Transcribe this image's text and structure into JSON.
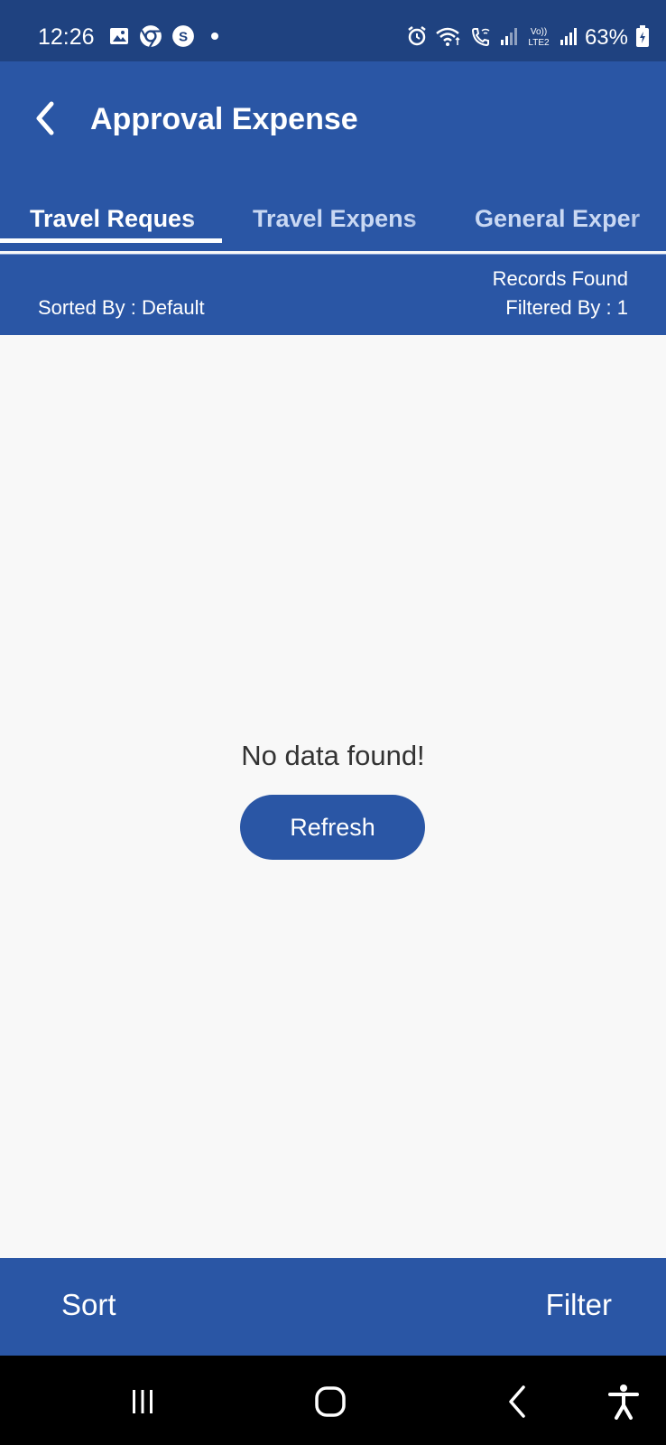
{
  "status_bar": {
    "time": "12:26",
    "battery": "63%",
    "left_icons": [
      "gallery-icon",
      "chrome-icon",
      "s-app-icon",
      "dot-icon"
    ],
    "right_icons": [
      "alarm-icon",
      "wifi-icon",
      "wifi-calling-icon",
      "signal-icon",
      "volte-icon",
      "signal-icon",
      "battery-icon"
    ]
  },
  "app_bar": {
    "title": "Approval Expense",
    "back_icon": "chevron-left-icon"
  },
  "tabs": [
    {
      "label": "Travel Reques",
      "selected": true
    },
    {
      "label": "Travel Expens",
      "selected": false
    },
    {
      "label": "General Exper",
      "selected": false
    }
  ],
  "info_bar": {
    "sorted_by": "Sorted By : Default",
    "records_found": "Records Found",
    "filtered_by": "Filtered By : 1"
  },
  "content": {
    "empty_message": "No data found!",
    "refresh_label": "Refresh"
  },
  "bottom_bar": {
    "sort_label": "Sort",
    "filter_label": "Filter"
  },
  "nav_bar": {
    "icons": [
      "recent-apps-icon",
      "home-icon",
      "back-icon",
      "accessibility-icon"
    ]
  },
  "colors": {
    "status_bar": "#1f4280",
    "primary": "#2a56a5",
    "background": "#f8f8f8",
    "text_dark": "#333333"
  }
}
